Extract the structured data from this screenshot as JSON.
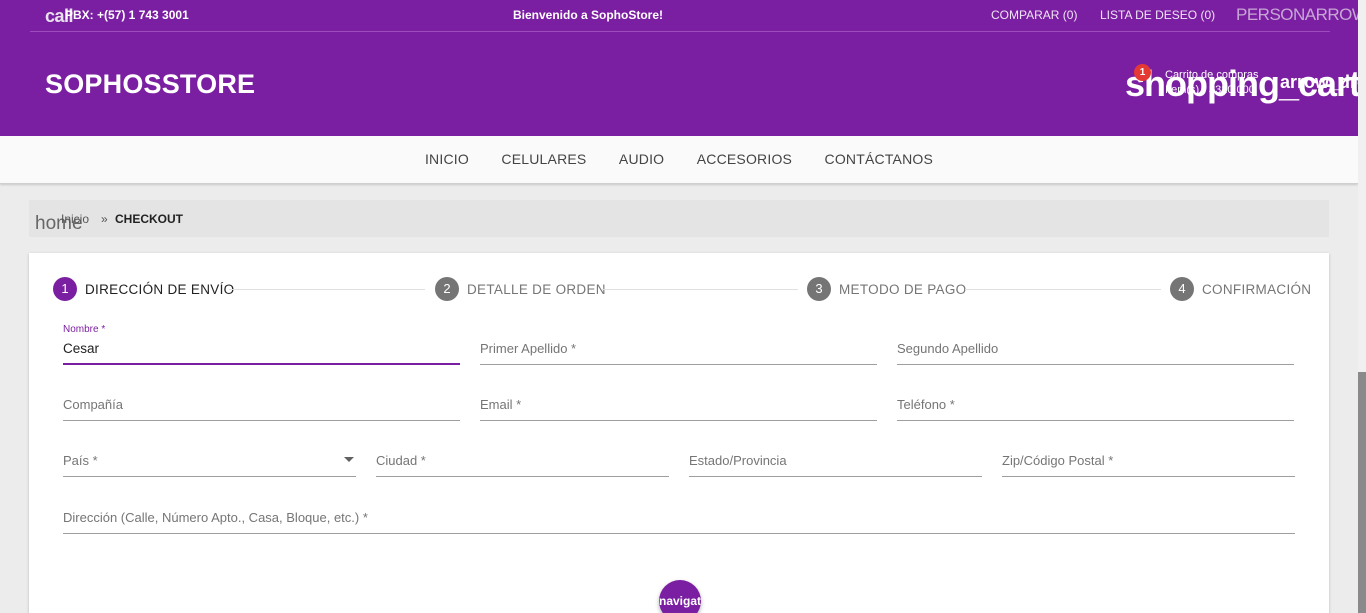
{
  "topbar": {
    "call_icon": "call",
    "phone": "PBX: +(57) 1 743 3001",
    "welcome": "Bienvenido a SophoStore!",
    "compare": "COMPARAR (0)",
    "wishlist": "LISTA DE DESEO (0)",
    "person_icon": "PERSONARROW"
  },
  "header": {
    "logo": "SOPHOSSTORE",
    "cart": {
      "icon": "shopping_cart",
      "badge": "1",
      "title": "Carrito de compras",
      "summary": "Item(s) - $320,000",
      "dropdown_icon": "arrow_drop"
    }
  },
  "nav": {
    "items": [
      "INICIO",
      "CELULARES",
      "AUDIO",
      "ACCESORIOS",
      "CONTÁCTANOS"
    ]
  },
  "breadcrumb": {
    "home_icon": "home",
    "link": "Inicio",
    "separator": "»",
    "current": "CHECKOUT"
  },
  "stepper": {
    "steps": [
      {
        "num": "1",
        "label": "DIRECCIÓN DE ENVÍO"
      },
      {
        "num": "2",
        "label": "DETALLE DE ORDEN"
      },
      {
        "num": "3",
        "label": "METODO DE PAGO"
      },
      {
        "num": "4",
        "label": "CONFIRMACIÓN"
      }
    ]
  },
  "form": {
    "nombre_label": "Nombre *",
    "nombre_value": "Cesar",
    "primer_apellido": "Primer Apellido *",
    "segundo_apellido": "Segundo Apellido",
    "compania": "Compañía",
    "email": "Email *",
    "telefono": "Teléfono *",
    "pais": "País *",
    "ciudad": "Ciudad *",
    "estado": "Estado/Provincia",
    "zip": "Zip/Código Postal *",
    "direccion": "Dirección (Calle, Número Apto., Casa, Bloque, etc.) *"
  },
  "fab": {
    "label": "navigate_next"
  },
  "colors": {
    "primary": "#7b1fa2",
    "badge": "#e53935",
    "inactive_step": "#757575"
  }
}
